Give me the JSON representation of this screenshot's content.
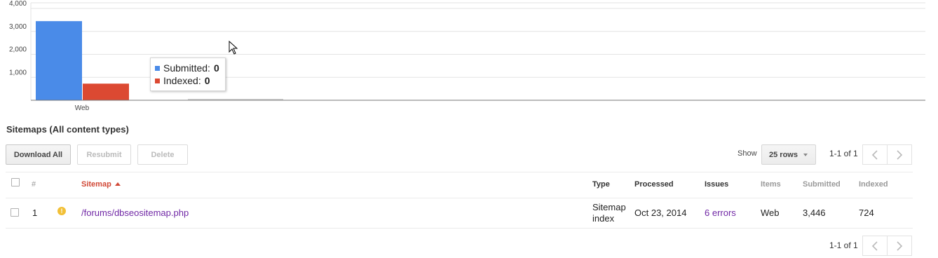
{
  "chart_data": {
    "type": "bar",
    "categories": [
      "Web"
    ],
    "series": [
      {
        "name": "Submitted",
        "values": [
          3446
        ],
        "color": "#4a8be8"
      },
      {
        "name": "Indexed",
        "values": [
          724
        ],
        "color": "#dc4932"
      }
    ],
    "yticks": [
      "1,000",
      "2,000",
      "3,000",
      "4,000"
    ],
    "ytick_values": [
      1000,
      2000,
      3000,
      4000
    ],
    "ylim": [
      0,
      4000
    ],
    "grid": true,
    "tooltip": {
      "rows": [
        {
          "label": "Submitted:",
          "value": "0",
          "color": "#4a8be8"
        },
        {
          "label": "Indexed:",
          "value": "0",
          "color": "#dc4932"
        }
      ]
    }
  },
  "section": {
    "title": "Sitemaps (All content types)"
  },
  "toolbar": {
    "download_label": "Download All",
    "resubmit_label": "Resubmit",
    "delete_label": "Delete",
    "show_label": "Show",
    "rows_label": "25 rows"
  },
  "pager": {
    "top_text": "1-1 of 1",
    "bottom_text": "1-1 of 1"
  },
  "table": {
    "headers": {
      "num": "#",
      "sitemap": "Sitemap",
      "type": "Type",
      "processed": "Processed",
      "issues": "Issues",
      "items": "Items",
      "submitted": "Submitted",
      "indexed": "Indexed"
    },
    "rows": [
      {
        "num": "1",
        "status_icon": "warning-icon",
        "sitemap": "/forums/dbseositemap.php",
        "type_line1": "Sitemap",
        "type_line2": "index",
        "processed": "Oct 23, 2014",
        "issues": "6 errors",
        "items": "Web",
        "submitted": "3,446",
        "indexed": "724"
      }
    ]
  },
  "colors": {
    "accent_red": "#d14836",
    "link_purple": "#7027a5",
    "warning": "#f2c037"
  }
}
